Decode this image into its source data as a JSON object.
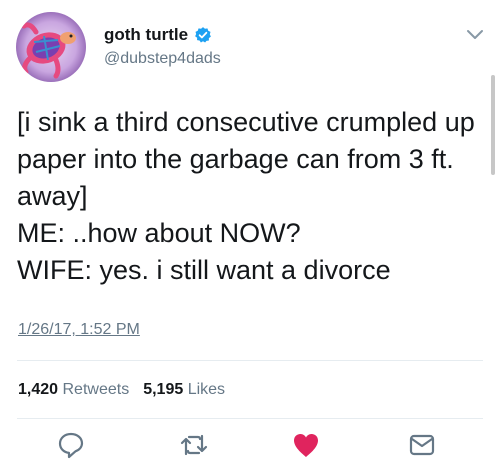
{
  "user": {
    "display_name": "goth turtle",
    "handle": "@dubstep4dads",
    "verified": true,
    "avatar_icon": "turtle-avatar"
  },
  "tweet": {
    "lines": [
      "[i sink a third consecutive crumpled up",
      "paper into the garbage can from 3 ft.",
      "away]",
      "ME: ..how about NOW?",
      "WIFE: yes. i still want a divorce"
    ],
    "timestamp": "1/26/17, 1:52 PM"
  },
  "stats": {
    "retweets_count": "1,420",
    "retweets_label": "Retweets",
    "likes_count": "5,195",
    "likes_label": "Likes"
  },
  "actions": {
    "reply_icon": "reply-icon",
    "retweet_icon": "retweet-icon",
    "like_icon": "heart-icon",
    "dm_icon": "envelope-icon"
  },
  "colors": {
    "text": "#14171a",
    "secondary": "#657786",
    "verified_blue": "#1da1f2",
    "like_red": "#e0245e",
    "divider": "#e6ecf0"
  }
}
